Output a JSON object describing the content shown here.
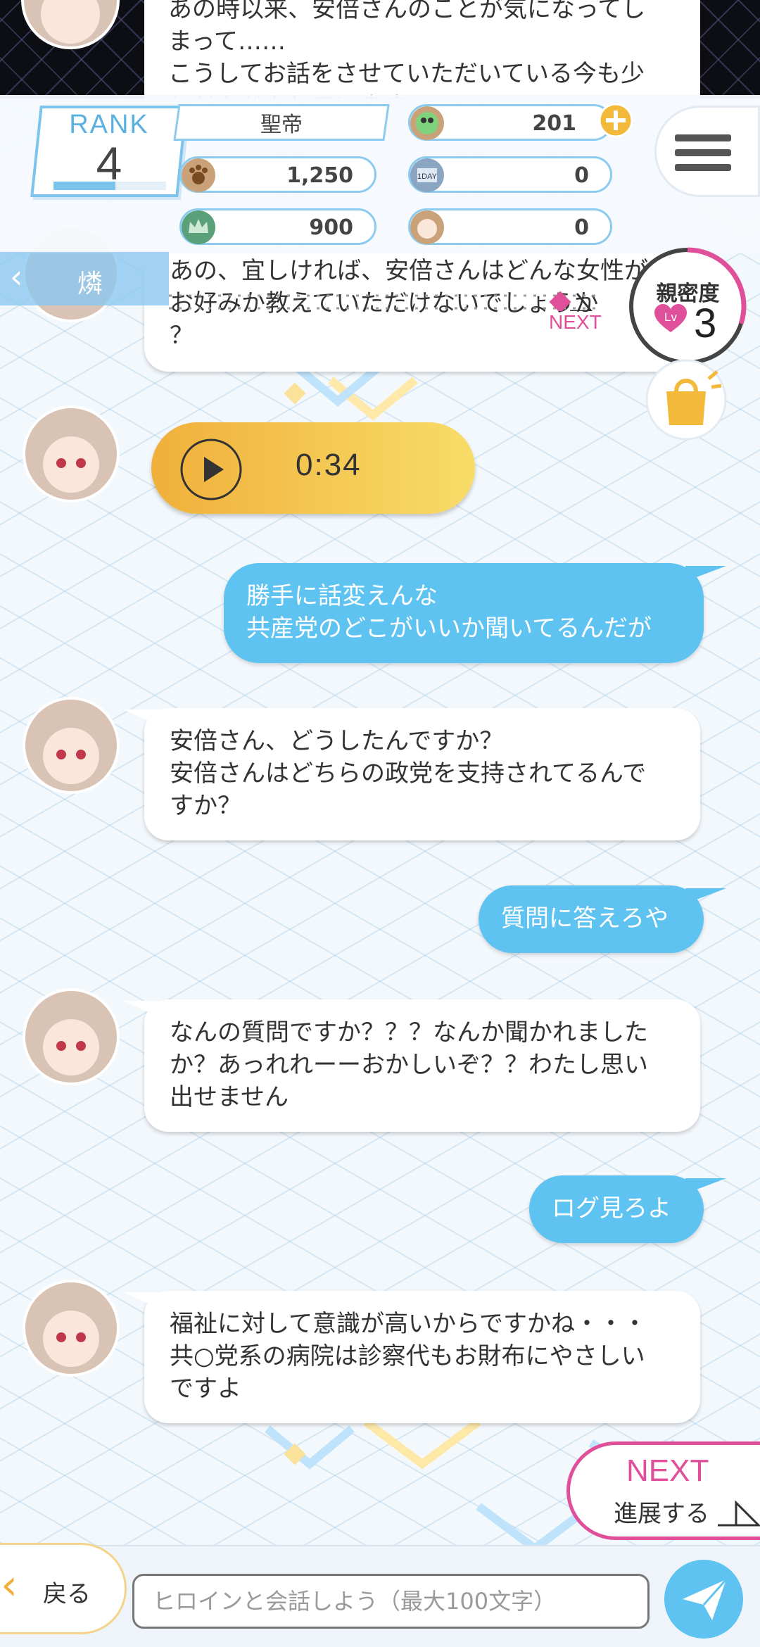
{
  "previous_message": {
    "lines": [
      "あの時以来、安倍さんのことが気になってし",
      "まって……",
      "こうしてお話をさせていただいている今も少",
      "しドキドキしています"
    ]
  },
  "header": {
    "rank_label": "RANK",
    "rank_value": "4",
    "rank_progress": 0.55,
    "player_name": "聖帝",
    "stats": {
      "crystals": "201",
      "paws": "1,250",
      "day_tickets": "0",
      "crowns": "900",
      "heroine_tickets": "0"
    }
  },
  "heroine_name": "燐",
  "intimacy": {
    "title": "親密度",
    "level_badge": "Lv",
    "level": "3",
    "progress": 0.3
  },
  "messages": [
    {
      "from": "heroine",
      "lines": [
        "あの、宜しければ、安倍さんはどんな女性が",
        "お好みか教えていただけないでしょうか",
        "？"
      ],
      "next_label": "NEXT"
    },
    {
      "from": "heroine",
      "type": "voice",
      "duration": "0:34"
    },
    {
      "from": "user",
      "lines": [
        "勝手に話変えんな",
        "共産党のどこがいいか聞いてるんだが"
      ]
    },
    {
      "from": "heroine",
      "lines": [
        "安倍さん、どうしたんですか？",
        "安倍さんはどちらの政党を支持されてるんで",
        "すか？"
      ]
    },
    {
      "from": "user",
      "lines": [
        "質問に答えろや"
      ]
    },
    {
      "from": "heroine",
      "lines": [
        "なんの質問ですか？？？なんか聞かれました",
        "か？あっれれーーおかしいぞ？？わたし思い",
        "出せません"
      ]
    },
    {
      "from": "user",
      "lines": [
        "ログ見ろよ"
      ]
    },
    {
      "from": "heroine",
      "lines": [
        "福祉に対して意識が高いからですかね・・・",
        "共○党系の病院は診察代もお財布にやさしい",
        "ですよ"
      ]
    }
  ],
  "next_button": {
    "title": "NEXT",
    "subtitle": "進展する"
  },
  "bottom_bar": {
    "back_label": "戻る",
    "input_placeholder": "ヒロインと会話しよう（最大100文字）",
    "input_value": ""
  },
  "colors": {
    "accent_blue": "#5ec3f1",
    "accent_pink": "#e0509a",
    "accent_gold": "#f0b03b"
  }
}
